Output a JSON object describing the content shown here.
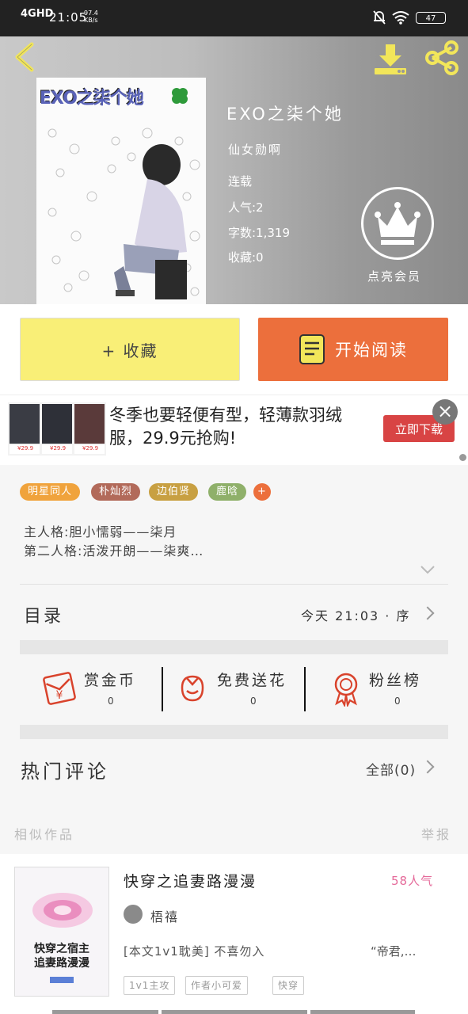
{
  "status_bar": {
    "network": "4GHD",
    "time": "21:05",
    "speed_value": "97.4",
    "speed_unit": "KB/s",
    "battery": "47"
  },
  "book": {
    "cover_title": "EXO之柒个她",
    "title": "EXO之柒个她",
    "author": "仙女勋啊",
    "status": "连载",
    "popularity": "人气:2",
    "word_count": "字数:1,319",
    "favorites": "收藏:0",
    "vip_label": "点亮会员"
  },
  "actions": {
    "favorite_label": "+ 收藏",
    "read_label": "开始阅读"
  },
  "ad": {
    "text": "冬季也要轻便有型，轻薄款羽绒服，29.9元抢购!",
    "button_label": "立即下载",
    "close_label": "×",
    "prices": [
      "¥29.9",
      "¥29.9",
      "¥29.9"
    ]
  },
  "tags": [
    {
      "label": "明星同人",
      "color": "#f0a33c"
    },
    {
      "label": "朴灿烈",
      "color": "#b26a5a"
    },
    {
      "label": "边伯贤",
      "color": "#c8a042"
    },
    {
      "label": "鹿晗",
      "color": "#8fb06a"
    },
    {
      "label": "+",
      "color": "#ec6f3c"
    }
  ],
  "synopsis": {
    "line1": "主人格:胆小懦弱——柒月",
    "line2": "第二人格:活泼开朗——柒爽…"
  },
  "toc": {
    "label": "目录",
    "info": "今天 21:03 · 序"
  },
  "stats": [
    {
      "label": "赏金币",
      "value": "0",
      "icon": "red-envelope-icon"
    },
    {
      "label": "免费送花",
      "value": "0",
      "icon": "flower-icon"
    },
    {
      "label": "粉丝榜",
      "value": "0",
      "icon": "medal-icon"
    }
  ],
  "comments": {
    "label": "热门评论",
    "all_label": "全部(0)"
  },
  "similar": {
    "label": "相似作品",
    "report_label": "举报"
  },
  "recommendation": {
    "cover_title_line1": "快穿之宿主",
    "cover_title_line2": "追妻路漫漫",
    "title": "快穿之追妻路漫漫",
    "popularity": "58人气",
    "author": "梧禧",
    "description": "[本文1v1耽美] 不喜勿入",
    "quote": "“帝君,…",
    "tags": [
      "1v1主攻",
      "作者小可爱",
      "快穿"
    ]
  },
  "colors": {
    "accent_orange": "#ec6f3c",
    "favorite_yellow": "#f9ef77",
    "icon_yellow": "#f2e65a",
    "icon_red": "#d9432c"
  }
}
